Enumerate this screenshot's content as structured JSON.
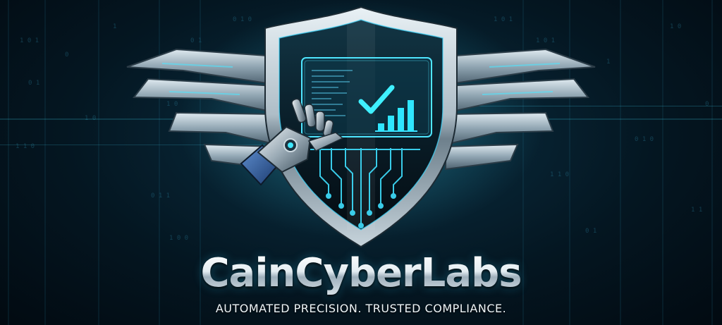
{
  "brand": {
    "name": "CainCyberLabs",
    "tagline": "AUTOMATED PRECISION. TRUSTED COMPLIANCE."
  },
  "emblem": {
    "icons": [
      "shield-icon",
      "wing-icon",
      "robotic-hand-icon",
      "checkmark-icon",
      "bar-chart-icon",
      "circuit-traces-icon"
    ],
    "bar_levels": [
      0.25,
      0.5,
      0.75,
      1.0
    ]
  },
  "colors": {
    "background": "#041621",
    "accent_cyan": "#2fe6ff",
    "shield_metal": "#c9d6de",
    "text": "#eef4f7"
  }
}
